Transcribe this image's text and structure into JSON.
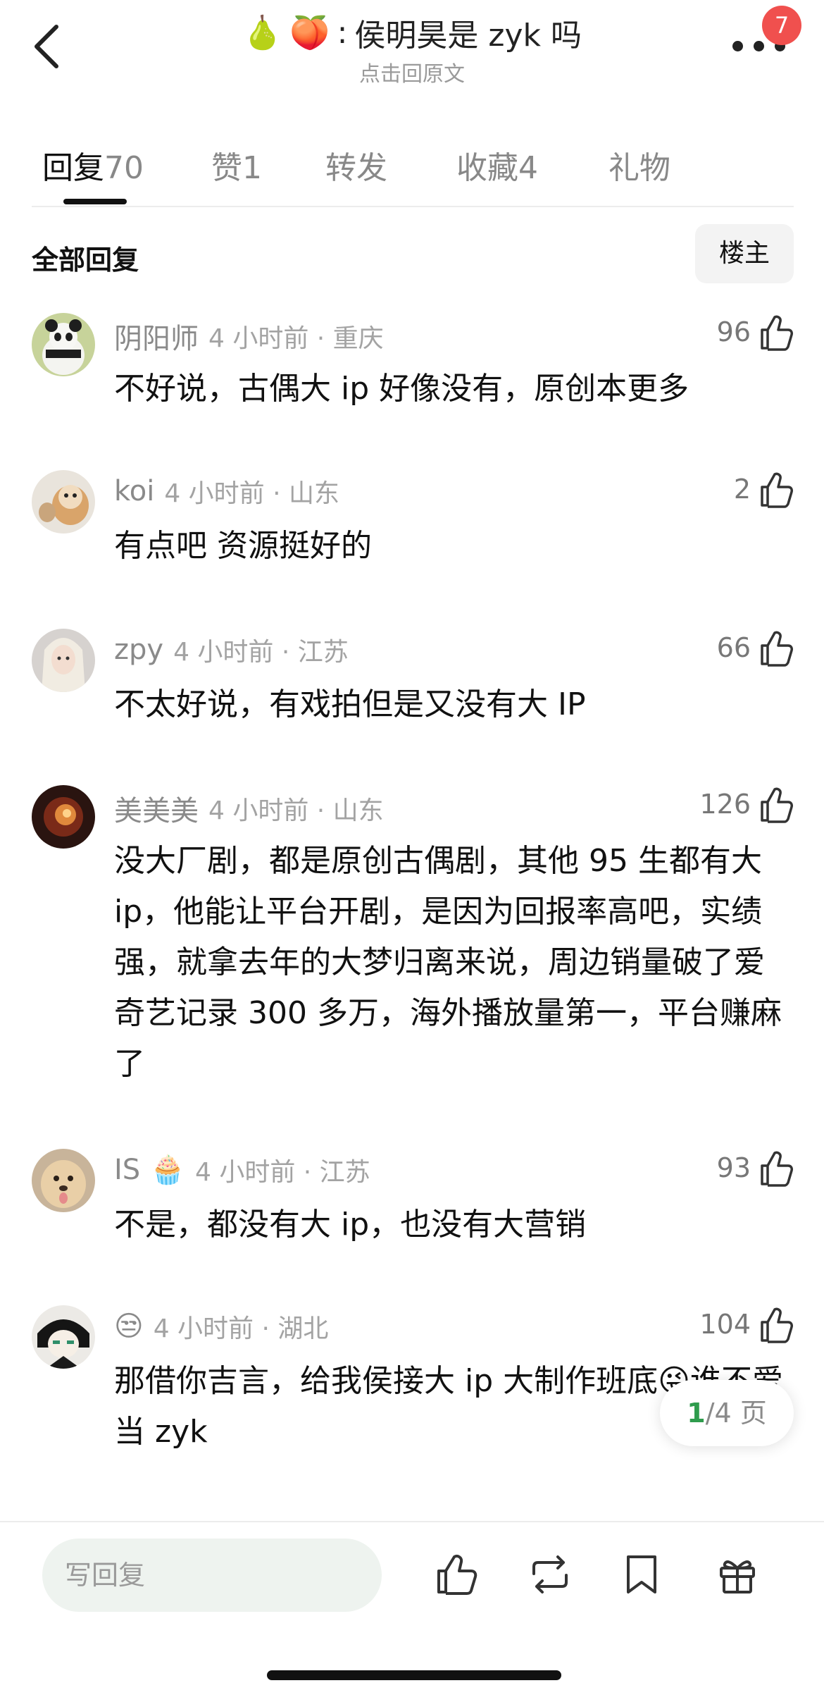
{
  "header": {
    "emoji_1": "🍐",
    "emoji_2": "🍑",
    "title_sep": ":",
    "title": "侯明昊是 zyk 吗",
    "subtitle": "点击回原文",
    "notification_count": "7"
  },
  "tabs": [
    {
      "label": "回复",
      "count": "70"
    },
    {
      "label": "赞",
      "count": "1"
    },
    {
      "label": "转发",
      "count": ""
    },
    {
      "label": "收藏",
      "count": "4"
    },
    {
      "label": "礼物",
      "count": ""
    }
  ],
  "filter": {
    "all_label": "全部回复",
    "owner_label": "楼主"
  },
  "comments": [
    {
      "username": "阴阳师",
      "time": "4 小时前 · 重庆",
      "likes": "96",
      "text": "不好说，古偶大 ip 好像没有，原创本更多"
    },
    {
      "username": "koi",
      "time": "4 小时前 · 山东",
      "likes": "2",
      "text": "有点吧 资源挺好的"
    },
    {
      "username": "zpy",
      "time": "4 小时前 · 江苏",
      "likes": "66",
      "text": "不太好说，有戏拍但是又没有大 IP"
    },
    {
      "username": "美美美",
      "time": "4 小时前 · 山东",
      "likes": "126",
      "text": "没大厂剧，都是原创古偶剧，其他 95 生都有大 ip，他能让平台开剧，是因为回报率高吧，实绩强，就拿去年的大梦归离来说，周边销量破了爱奇艺记录 300 多万，海外播放量第一，平台赚麻了"
    },
    {
      "username": "IS",
      "username_emoji": "🧁",
      "time": "4 小时前 · 江苏",
      "likes": "93",
      "text": "不是，都没有大 ip，也没有大营销"
    },
    {
      "username": "😒",
      "time": "4 小时前 · 湖北",
      "likes": "104",
      "text": "那借你吉言，给我侯接大 ip 大制作班底😜谁不爱当 zyk"
    }
  ],
  "pager": {
    "current": "1",
    "total": "/4 页"
  },
  "bottom_bar": {
    "reply_placeholder": "写回复"
  },
  "icons": {
    "back": "back-arrow-icon",
    "more": "more-dots-icon",
    "like": "thumbs-up-icon",
    "repost": "repost-icon",
    "bookmark": "bookmark-icon",
    "gift": "gift-icon"
  },
  "colors": {
    "accent_green": "#2f9c4d",
    "badge_red": "#f0504e",
    "input_bg": "#eef3ef"
  }
}
